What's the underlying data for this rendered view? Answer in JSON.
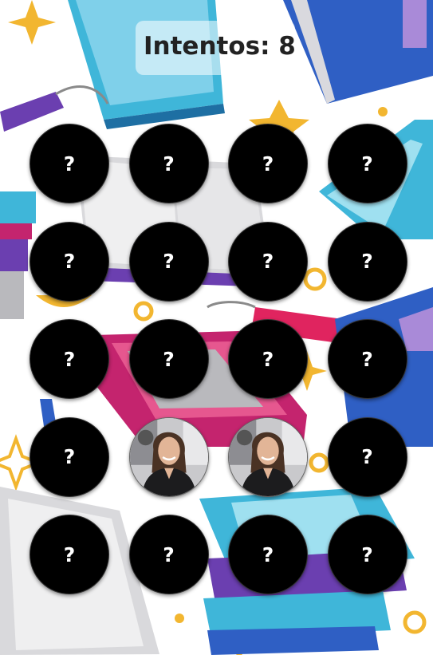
{
  "header": {
    "attempts_label": "Intentos: 8"
  },
  "board": {
    "hidden_symbol": "?",
    "columns": 4,
    "cards": [
      {
        "state": "hidden"
      },
      {
        "state": "hidden"
      },
      {
        "state": "hidden"
      },
      {
        "state": "hidden"
      },
      {
        "state": "hidden"
      },
      {
        "state": "hidden"
      },
      {
        "state": "hidden"
      },
      {
        "state": "hidden"
      },
      {
        "state": "hidden"
      },
      {
        "state": "hidden"
      },
      {
        "state": "hidden"
      },
      {
        "state": "hidden"
      },
      {
        "state": "hidden"
      },
      {
        "state": "revealed",
        "image": "woman-portrait"
      },
      {
        "state": "revealed",
        "image": "woman-portrait"
      },
      {
        "state": "hidden"
      },
      {
        "state": "hidden"
      },
      {
        "state": "hidden"
      },
      {
        "state": "hidden"
      },
      {
        "state": "hidden"
      }
    ]
  },
  "background": {
    "theme": "books-pattern",
    "colors": {
      "cyan": "#3fb6d9",
      "blue": "#2f5fc4",
      "magenta": "#c4246e",
      "purple": "#6b3fb0",
      "yellow": "#f2b630",
      "gray": "#b9b9bd"
    }
  }
}
